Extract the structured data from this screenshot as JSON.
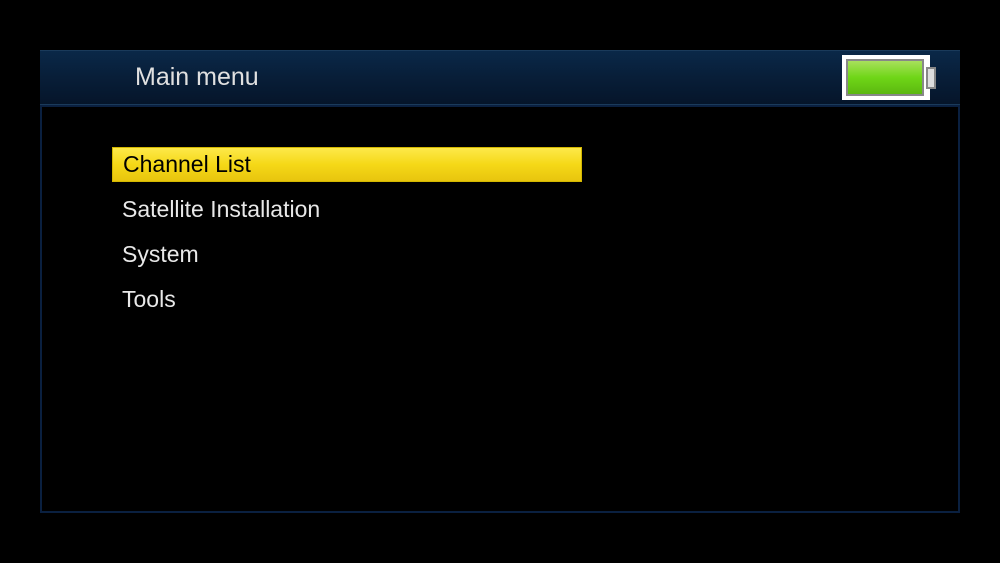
{
  "header": {
    "title": "Main menu",
    "battery_icon": "battery-full"
  },
  "menu": {
    "items": [
      {
        "label": "Channel List",
        "selected": true
      },
      {
        "label": "Satellite Installation",
        "selected": false
      },
      {
        "label": "System",
        "selected": false
      },
      {
        "label": "Tools",
        "selected": false
      }
    ]
  }
}
